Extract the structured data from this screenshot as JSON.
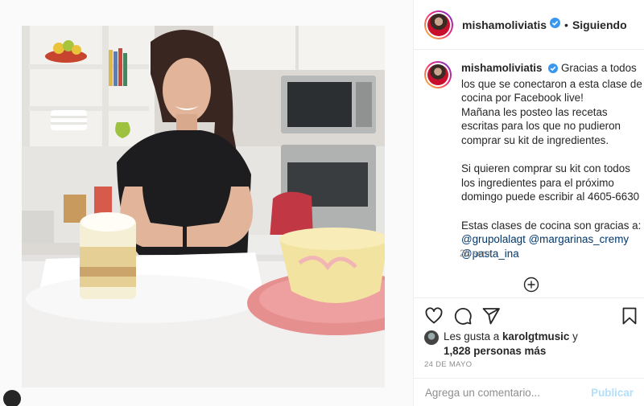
{
  "post": {
    "username": "mishamoliviatis",
    "follow_label": "Siguiendo",
    "separator": "•",
    "caption_lines": [
      "Gracias a todos",
      "los que se conectaron a esta clase de",
      "cocina por Facebook live!",
      "Mañana les posteo las recetas",
      "escritas para los que no pudieron",
      "comprar su kit de ingredientes."
    ],
    "caption_lines_2": [
      "Si quieren comprar su kit con todos",
      "los ingredientes para el próximo",
      "domingo puede escribir al 4605-6630"
    ],
    "caption_line_3": "Estas clases de cocina son gracias a:",
    "mentions": [
      "@grupolalagt",
      "@margarinas_cremy",
      "@pasta_ina"
    ],
    "caption_time": "26 sem",
    "likes_prefix": "Les gusta a",
    "likes_user": "karolgtmusic",
    "likes_connector": "y",
    "likes_count": "1,828 personas más",
    "date": "24 DE MAYO",
    "comment_placeholder": "Agrega un comentario...",
    "publish_label": "Publicar"
  },
  "icons": {
    "verified": "verified-badge-icon",
    "like": "heart-icon",
    "comment": "comment-icon",
    "share": "share-icon",
    "save": "bookmark-icon",
    "load_more": "plus-circle-icon"
  },
  "colors": {
    "link": "#00376b",
    "verified": "#3897f0",
    "publish_disabled": "#b2dffc",
    "muted": "#8e8e8e"
  }
}
